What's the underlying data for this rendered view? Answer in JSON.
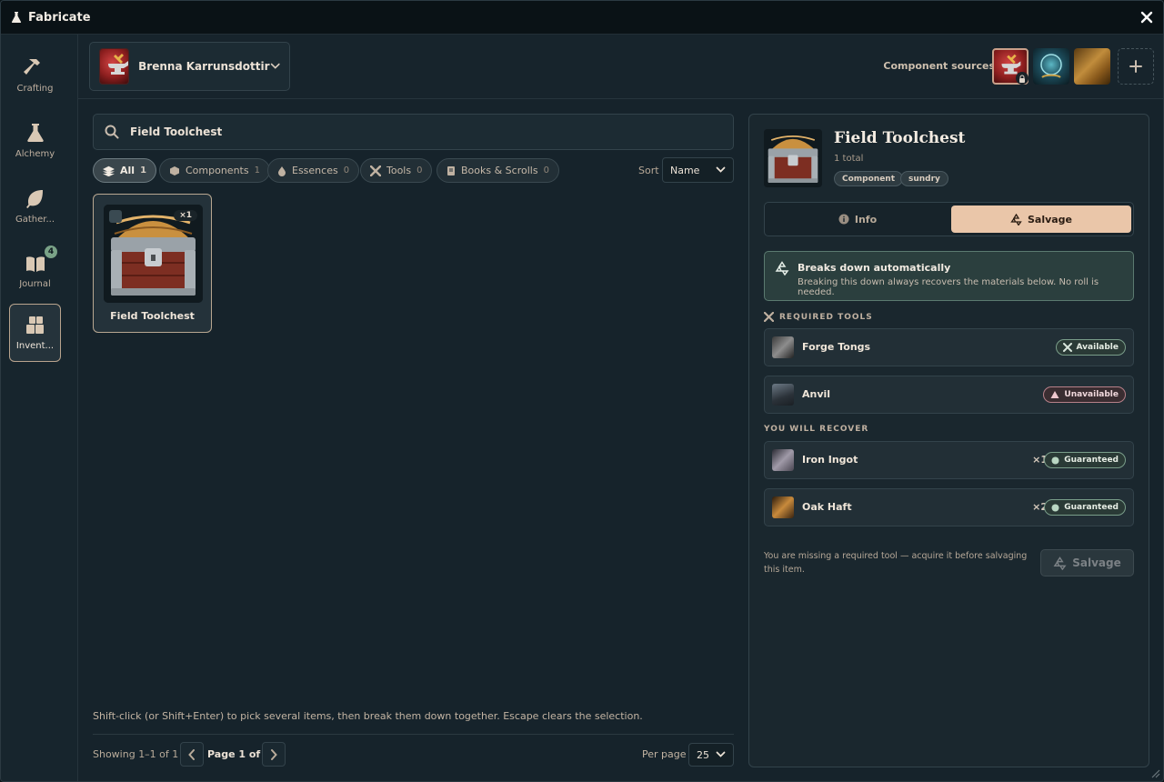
{
  "window": {
    "title": "Fabricate"
  },
  "sidebar": {
    "items": [
      {
        "label": "Crafting",
        "icon": "hammer-icon"
      },
      {
        "label": "Alchemy",
        "icon": "flask-icon"
      },
      {
        "label": "Gather...",
        "icon": "leaf-icon"
      },
      {
        "label": "Journal",
        "icon": "book-icon",
        "badge": "4"
      },
      {
        "label": "Invent...",
        "icon": "boxes-icon",
        "active": true
      }
    ]
  },
  "header": {
    "character_name": "Brenna Karrunsdottir",
    "sources_label": "Component sources"
  },
  "search": {
    "value": "Field Toolchest",
    "placeholder": ""
  },
  "filters": [
    {
      "label": "All",
      "count": "1",
      "active": true
    },
    {
      "label": "Components",
      "count": "1"
    },
    {
      "label": "Essences",
      "count": "0"
    },
    {
      "label": "Tools",
      "count": "0"
    },
    {
      "label": "Books & Scrolls",
      "count": "0"
    }
  ],
  "sort": {
    "label": "Sort",
    "value": "Name"
  },
  "items": [
    {
      "name": "Field Toolchest",
      "qty": "×1"
    }
  ],
  "hint": "Shift-click (or Shift+Enter) to pick several items, then break them down together. Escape clears the selection.",
  "pagination": {
    "showing": "Showing 1–1 of 1",
    "page_text": "Page 1 of 1",
    "per_page_label": "Per page",
    "per_page_value": "25"
  },
  "detail": {
    "title": "Field Toolchest",
    "total": "1 total",
    "tags": [
      "Component",
      "sundry"
    ],
    "tabs": {
      "info": "Info",
      "salvage": "Salvage"
    },
    "banner": {
      "title": "Breaks down automatically",
      "desc": "Breaking this down always recovers the materials below. No roll is needed."
    },
    "required_tools_label": "REQUIRED TOOLS",
    "tools": [
      {
        "name": "Forge Tongs",
        "status": "Available"
      },
      {
        "name": "Anvil",
        "status": "Unavailable"
      }
    ],
    "recover_label": "YOU WILL RECOVER",
    "recover": [
      {
        "name": "Iron Ingot",
        "qty": "×1",
        "status": "Guaranteed"
      },
      {
        "name": "Oak Haft",
        "qty": "×2",
        "status": "Guaranteed"
      }
    ],
    "warning": "You are missing a required tool — acquire it before salvaging this item.",
    "salvage_button": "Salvage"
  },
  "colors": {
    "accent": "#eac6a9",
    "available": "#7a9e8a",
    "unavailable": "#b78089",
    "badge": "#7aa287"
  }
}
